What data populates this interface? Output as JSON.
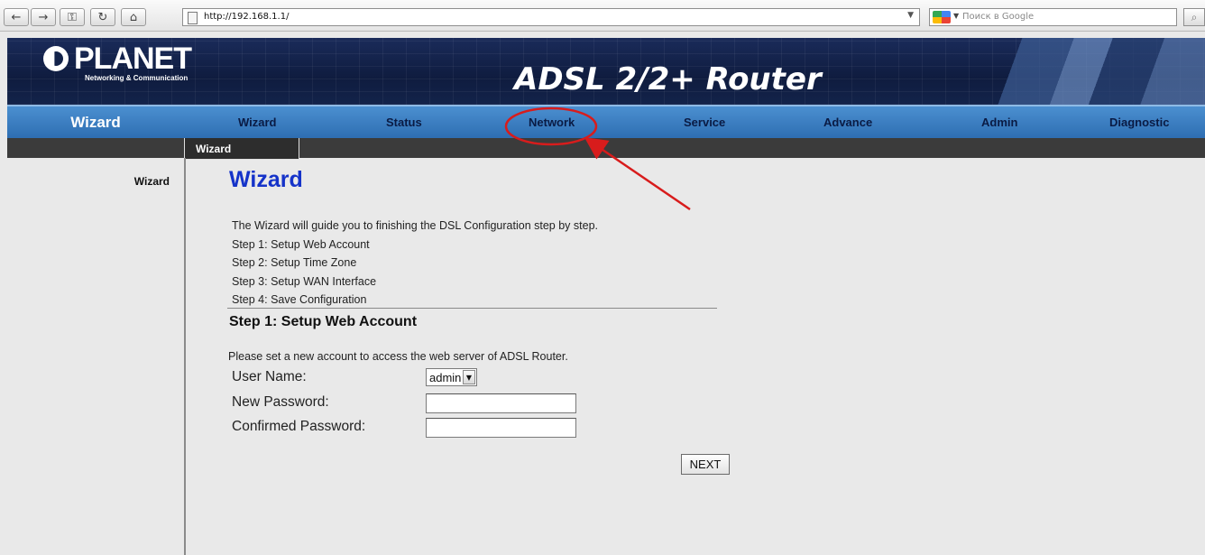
{
  "browser": {
    "url": "http://192.168.1.1/",
    "search_placeholder": "Поиск в Google"
  },
  "header": {
    "logo_text": "PLANET",
    "logo_tagline": "Networking & Communication",
    "product_title": "ADSL 2/2+ Router"
  },
  "nav": {
    "section_title": "Wizard",
    "items": [
      "Wizard",
      "Status",
      "Network",
      "Service",
      "Advance",
      "Admin",
      "Diagnostic"
    ]
  },
  "subnav": {
    "active_tab": "Wizard"
  },
  "sidebar": {
    "items": [
      "Wizard"
    ]
  },
  "content": {
    "title": "Wizard",
    "intro_lines": [
      "The Wizard will guide you to finishing the DSL Configuration step by step.",
      "Step 1: Setup Web Account",
      "Step 2: Setup Time Zone",
      "Step 3: Setup WAN Interface",
      "Step 4: Save Configuration"
    ],
    "step_title": "Step 1: Setup Web Account",
    "description": "Please set a new account to access the web server of ADSL Router.",
    "form": {
      "user_name_label": "User Name:",
      "user_name_value": "admin",
      "new_password_label": "New Password:",
      "new_password_value": "",
      "confirmed_password_label": "Confirmed Password:",
      "confirmed_password_value": ""
    },
    "next_label": "NEXT"
  },
  "colors": {
    "nav_blue": "#2c6cb0",
    "title_blue": "#1533c9",
    "annotation_red": "#d81c1c"
  },
  "icons": [
    "back-icon",
    "forward-icon",
    "key-icon",
    "reload-icon",
    "home-icon",
    "page-icon",
    "google-icon",
    "search-go-icon"
  ]
}
